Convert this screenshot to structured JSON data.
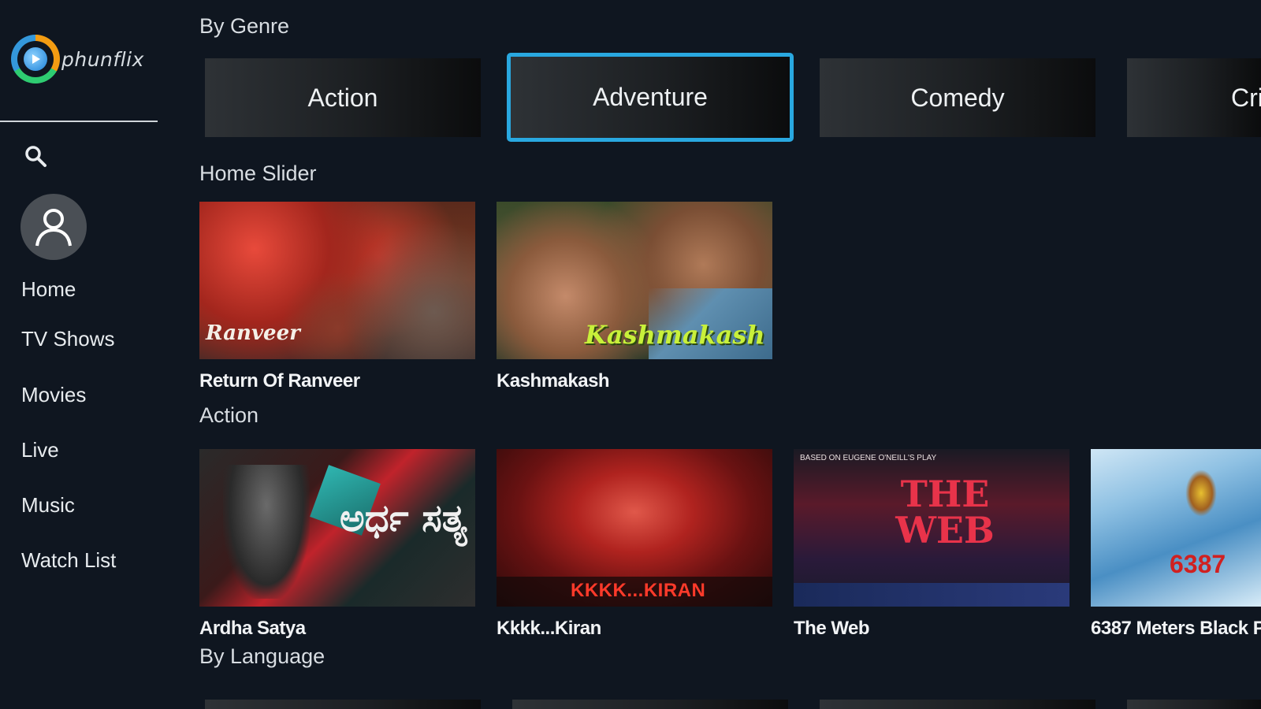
{
  "app": {
    "logo_text": "phunflix",
    "icons": {
      "search": "search-icon",
      "avatar": "user-icon",
      "logo": "play-icon"
    },
    "accent": "#29a8e0"
  },
  "sidebar": {
    "items": [
      {
        "label": "Home"
      },
      {
        "label": "TV Shows"
      },
      {
        "label": "Movies"
      },
      {
        "label": "Live"
      },
      {
        "label": "Music"
      },
      {
        "label": "Watch List"
      }
    ]
  },
  "sections": {
    "genre": {
      "title": "By Genre",
      "tiles": [
        {
          "label": "Action"
        },
        {
          "label": "Adventure",
          "focused": true
        },
        {
          "label": "Comedy"
        },
        {
          "label": "Cri"
        }
      ]
    },
    "home_slider": {
      "title": "Home Slider",
      "cards": [
        {
          "title": "Return Of Ranveer",
          "poster_text": "Ranveer"
        },
        {
          "title": "Kashmakash",
          "poster_text": "Kashmakash"
        }
      ]
    },
    "action": {
      "title": "Action",
      "cards": [
        {
          "title": "Ardha Satya",
          "poster_text": "ಅರ್ಧ ಸತ್ಯ"
        },
        {
          "title": "Kkkk...Kiran",
          "poster_text": "KKKK...KIRAN"
        },
        {
          "title": "The Web",
          "poster_text": "THE WEB",
          "poster_subtext": "BASED ON EUGENE O'NEILL'S PLAY"
        },
        {
          "title": "6387 Meters Black P",
          "poster_text": "6387"
        }
      ]
    },
    "language": {
      "title": "By Language"
    }
  }
}
